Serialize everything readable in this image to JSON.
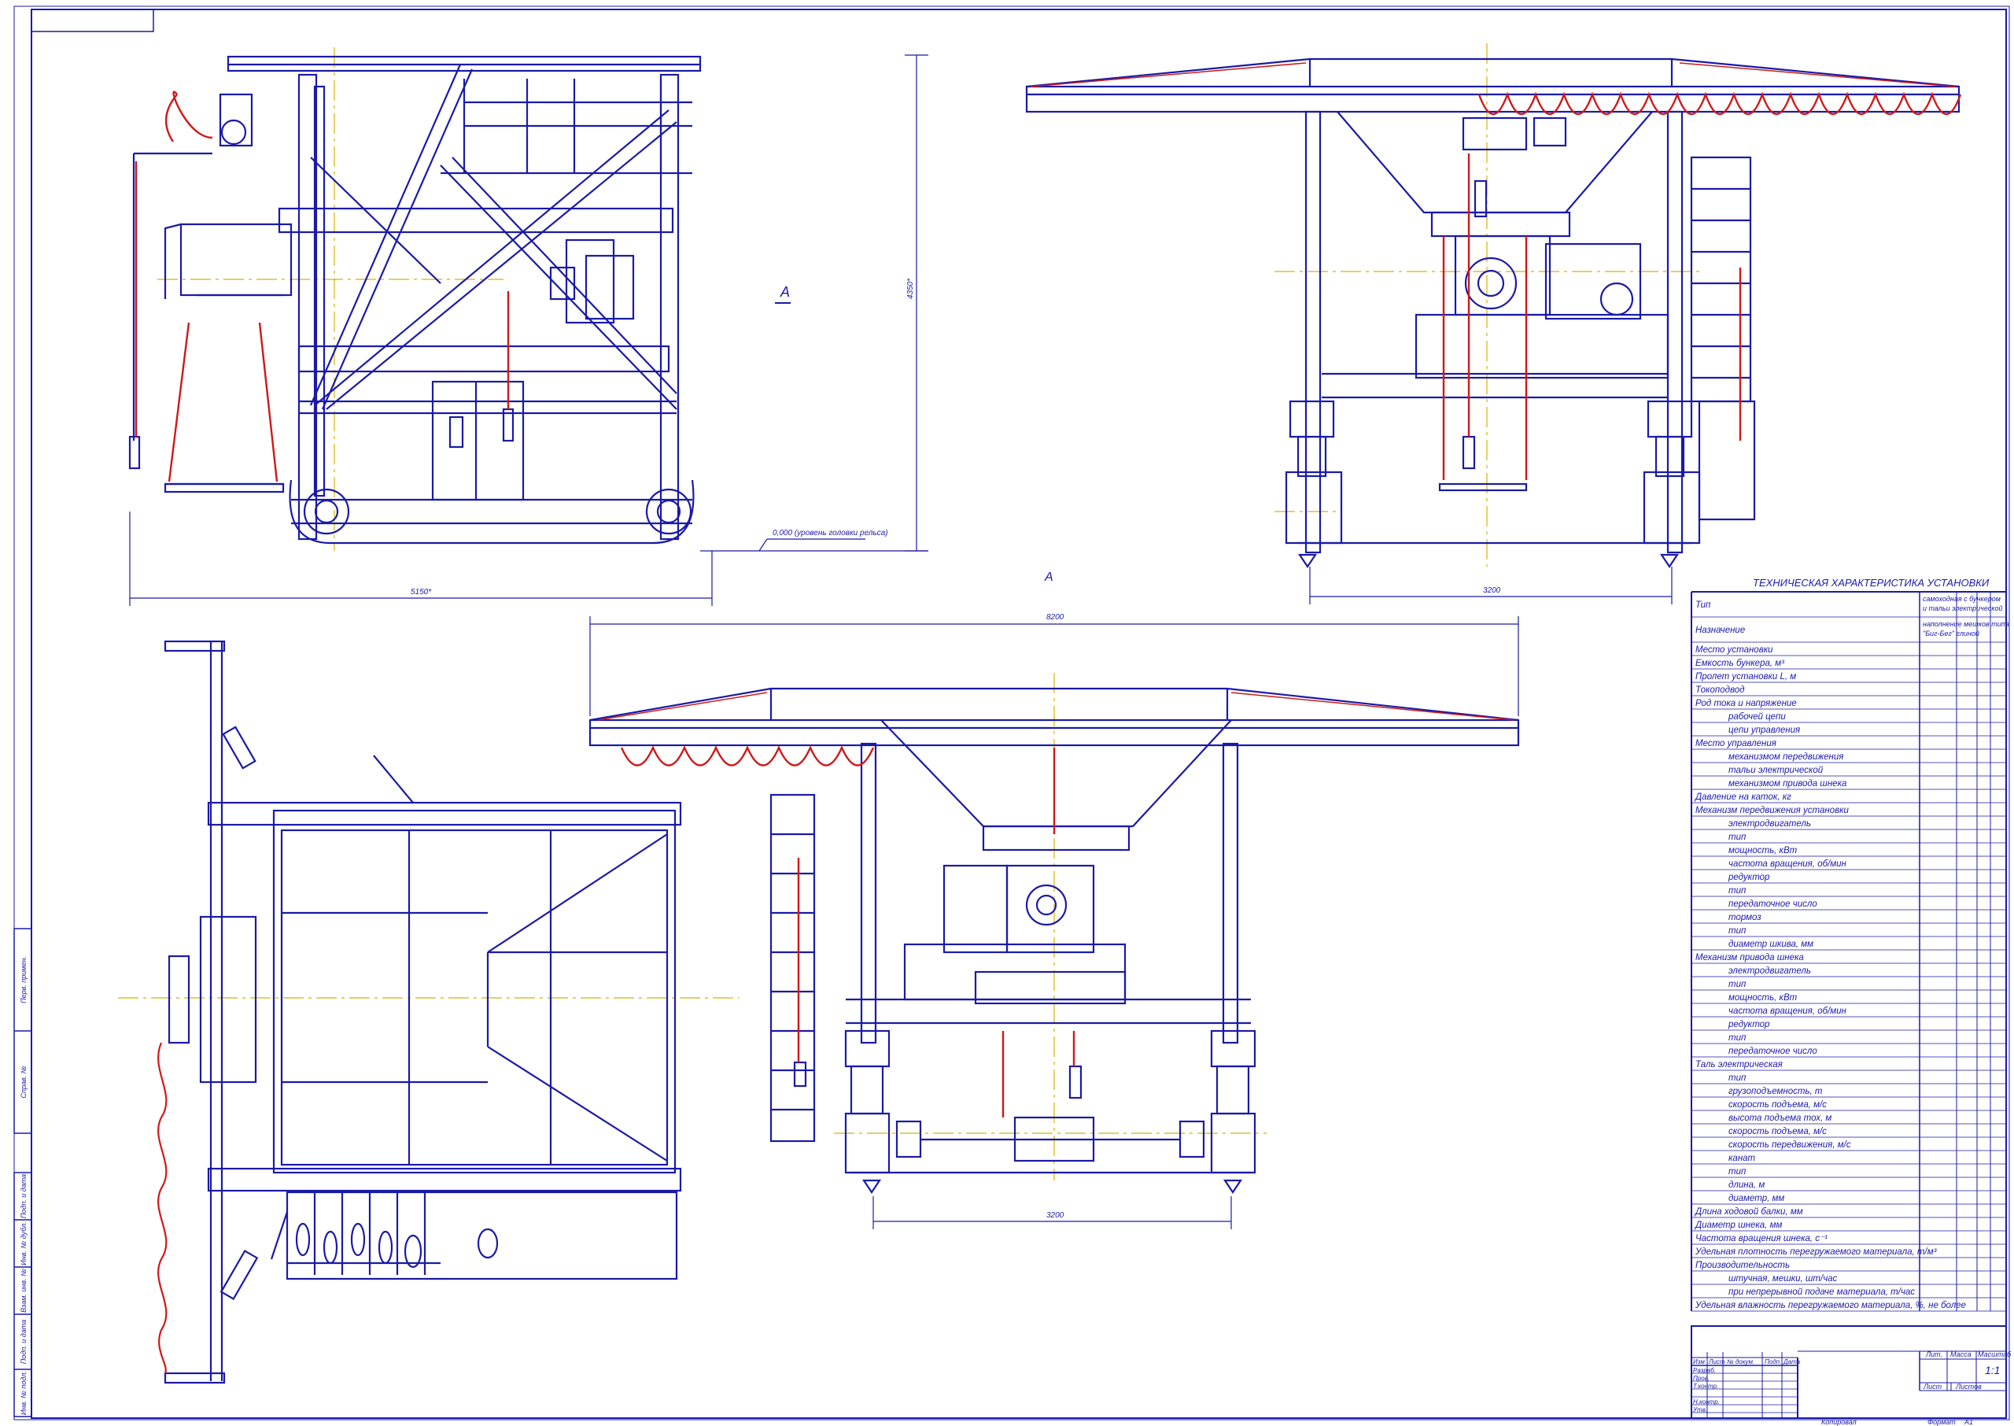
{
  "drawing": {
    "view_label": "А",
    "section_marker": "А",
    "level_note": "0,000 (уровень головки рельса)",
    "dims": {
      "side_width": "5150*",
      "side_height": "4350*",
      "front_span": "3200",
      "top_span": "8200",
      "bottom_span": "3200"
    }
  },
  "spec_table": {
    "title": "ТЕХНИЧЕСКАЯ ХАРАКТЕРИСТИКА УСТАНОВКИ",
    "rows": [
      {
        "label": "Тип",
        "indent": 0,
        "value": "самоходная с бункером и тальи электрической",
        "tall": true
      },
      {
        "label": "Назначение",
        "indent": 0,
        "value": "наполнение мешков типа \"Биг-Бег\" глиной",
        "tall": true
      },
      {
        "label": "Место установки",
        "indent": 0,
        "value": ""
      },
      {
        "label": "Емкость бункера, м³",
        "indent": 0,
        "value": ""
      },
      {
        "label": "Пролет установки L, м",
        "indent": 0,
        "value": ""
      },
      {
        "label": "Токоподвод",
        "indent": 0,
        "value": ""
      },
      {
        "label": "Род тока и напряжение",
        "indent": 0,
        "value": ""
      },
      {
        "label": "рабочей цепи",
        "indent": 1,
        "value": ""
      },
      {
        "label": "цепи управления",
        "indent": 1,
        "value": ""
      },
      {
        "label": "Место управления",
        "indent": 0,
        "value": ""
      },
      {
        "label": "механизмом передвижения",
        "indent": 1,
        "value": ""
      },
      {
        "label": "тальи электрической",
        "indent": 1,
        "value": ""
      },
      {
        "label": "механизмом привода шнека",
        "indent": 1,
        "value": ""
      },
      {
        "label": "Давление на каток, кг",
        "indent": 0,
        "value": ""
      },
      {
        "label": "Механизм передвижения установки",
        "indent": 0,
        "value": ""
      },
      {
        "label": "электродвигатель",
        "indent": 1,
        "value": ""
      },
      {
        "label": "тип",
        "indent": 1,
        "value": ""
      },
      {
        "label": "мощность, кВт",
        "indent": 1,
        "value": ""
      },
      {
        "label": "частота вращения, об/мин",
        "indent": 1,
        "value": ""
      },
      {
        "label": "редуктор",
        "indent": 1,
        "value": ""
      },
      {
        "label": "тип",
        "indent": 1,
        "value": ""
      },
      {
        "label": "передаточное число",
        "indent": 1,
        "value": ""
      },
      {
        "label": "тормоз",
        "indent": 1,
        "value": ""
      },
      {
        "label": "тип",
        "indent": 1,
        "value": ""
      },
      {
        "label": "диаметр шкива, мм",
        "indent": 1,
        "value": ""
      },
      {
        "label": "Механизм привода шнека",
        "indent": 0,
        "value": ""
      },
      {
        "label": "электродвигатель",
        "indent": 1,
        "value": ""
      },
      {
        "label": "тип",
        "indent": 1,
        "value": ""
      },
      {
        "label": "мощность, кВт",
        "indent": 1,
        "value": ""
      },
      {
        "label": "частота вращения, об/мин",
        "indent": 1,
        "value": ""
      },
      {
        "label": "редуктор",
        "indent": 1,
        "value": ""
      },
      {
        "label": "тип",
        "indent": 1,
        "value": ""
      },
      {
        "label": "передаточное число",
        "indent": 1,
        "value": ""
      },
      {
        "label": "Таль электрическая",
        "indent": 0,
        "value": ""
      },
      {
        "label": "тип",
        "indent": 1,
        "value": ""
      },
      {
        "label": "грузоподъемность, т",
        "indent": 1,
        "value": ""
      },
      {
        "label": "скорость подъема, м/с",
        "indent": 1,
        "value": ""
      },
      {
        "label": "высота подъема тох, м",
        "indent": 1,
        "value": ""
      },
      {
        "label": "скорость подъема, м/с",
        "indent": 1,
        "value": ""
      },
      {
        "label": "скорость передвижения, м/с",
        "indent": 1,
        "value": ""
      },
      {
        "label": "канат",
        "indent": 1,
        "value": ""
      },
      {
        "label": "тип",
        "indent": 1,
        "value": ""
      },
      {
        "label": "длина, м",
        "indent": 1,
        "value": ""
      },
      {
        "label": "диаметр, мм",
        "indent": 1,
        "value": ""
      },
      {
        "label": "Длина ходовой балки, мм",
        "indent": 0,
        "value": ""
      },
      {
        "label": "Диаметр шнека, мм",
        "indent": 0,
        "value": ""
      },
      {
        "label": "Частота вращения шнека, с⁻¹",
        "indent": 0,
        "value": ""
      },
      {
        "label": "Удельная плотность перегружаемого материала, т/м³",
        "indent": 0,
        "value": ""
      },
      {
        "label": "Производительность",
        "indent": 0,
        "value": ""
      },
      {
        "label": "штучная, мешки, шт/час",
        "indent": 1,
        "value": ""
      },
      {
        "label": "при непрерывной подаче материала, т/час",
        "indent": 1,
        "value": ""
      },
      {
        "label": "Удельная влажность перегружаемого материала, %, не более",
        "indent": 0,
        "value": ""
      }
    ]
  },
  "title_block": {
    "col_headers": [
      "Изм",
      "Лист",
      "№ докум.",
      "Подп.",
      "Дата"
    ],
    "roles": [
      "Разраб.",
      "Пров.",
      "Т.контр.",
      "",
      "Н.контр.",
      "Утв."
    ],
    "lit_label": "Лит.",
    "mass_label": "Масса",
    "scale_label": "Масштаб",
    "scale_value": "1:1",
    "sheet_label": "Лист",
    "sheets_label": "Листов",
    "copied_label": "Копировал",
    "format_label": "Формат",
    "format_value": "А1"
  },
  "side_stamps": [
    "Перв. примен.",
    "Справ. №",
    "Подп. и дата",
    "Инв. № дубл.",
    "Взам. инв. №",
    "Подп. и дата",
    "Инв. № подл."
  ],
  "colors": {
    "line": "#1a1aa8",
    "rope": "#d01818",
    "axis": "#d4b400"
  }
}
